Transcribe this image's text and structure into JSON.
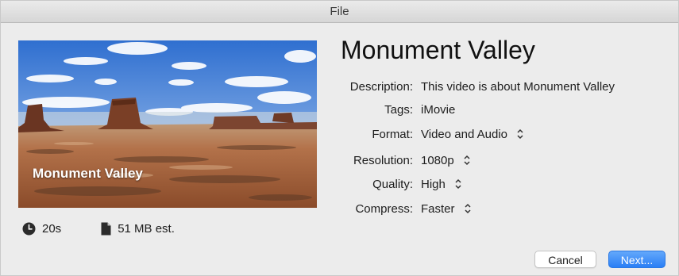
{
  "window": {
    "title": "File"
  },
  "preview": {
    "caption": "Monument Valley",
    "duration": "20s",
    "size": "51 MB est."
  },
  "details": {
    "title": "Monument Valley",
    "description_label": "Description:",
    "description_value": "This video is about Monument Valley",
    "tags_label": "Tags:",
    "tags_value": "iMovie",
    "format_label": "Format:",
    "format_value": "Video and Audio",
    "resolution_label": "Resolution:",
    "resolution_value": "1080p",
    "quality_label": "Quality:",
    "quality_value": "High",
    "compress_label": "Compress:",
    "compress_value": "Faster"
  },
  "buttons": {
    "cancel": "Cancel",
    "next": "Next..."
  },
  "colors": {
    "window_bg": "#ececec",
    "accent": "#2a7ff5",
    "sky": "#4f86d6",
    "desert": "#b06a3e"
  },
  "icons": {
    "duration": "clock-icon",
    "size": "document-icon",
    "popup": "up-down-chevron-icon"
  }
}
